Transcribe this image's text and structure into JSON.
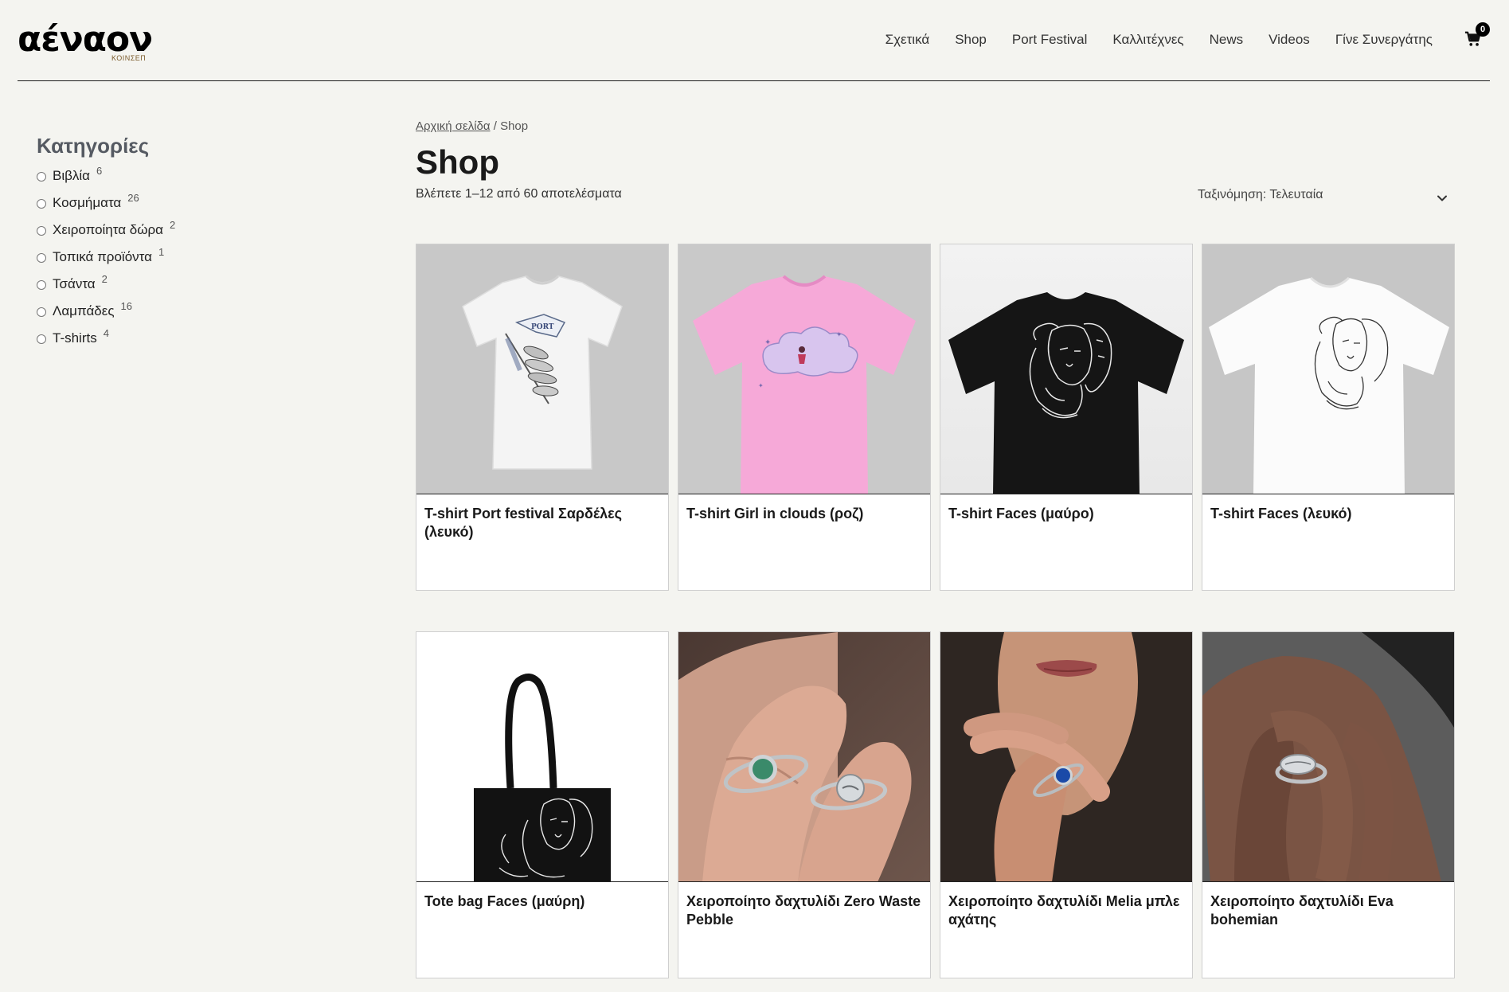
{
  "brand": {
    "logo_text": "αένα",
    "logo_sub": "ΚΟΙΝΣΕΠ"
  },
  "nav": {
    "items": [
      "Σχετικά",
      "Shop",
      "Port Festival",
      "Καλλιτέχνες",
      "News",
      "Videos",
      "Γίνε Συνεργάτης"
    ],
    "cart_count": "0"
  },
  "sidebar": {
    "title": "Κατηγορίες",
    "categories": [
      {
        "label": "Βιβλία",
        "count": "6"
      },
      {
        "label": "Κοσμήματα",
        "count": "26"
      },
      {
        "label": "Χειροποίητα δώρα",
        "count": "2"
      },
      {
        "label": "Τοπικά προϊόντα",
        "count": "1"
      },
      {
        "label": "Τσάντα",
        "count": "2"
      },
      {
        "label": "Λαμπάδες",
        "count": "16"
      },
      {
        "label": "T-shirts",
        "count": "4"
      }
    ]
  },
  "main": {
    "breadcrumb_home": "Αρχική σελίδα",
    "breadcrumb_sep": " / ",
    "breadcrumb_current": "Shop",
    "title": "Shop",
    "results": "Βλέπετε 1–12 από 60 αποτελέσματα",
    "sort_label": "Ταξινόμηση: Τελευταία"
  },
  "products": [
    {
      "title": "T-shirt Port festival Σαρδέλες (λευκό)"
    },
    {
      "title": "T-shirt Girl in clouds (ροζ)"
    },
    {
      "title": "T-shirt Faces (μαύρο)"
    },
    {
      "title": "T-shirt Faces (λευκό)"
    },
    {
      "title": "Tote bag Faces (μαύρη)"
    },
    {
      "title": "Χειροποίητο δαχτυλίδι Zero Waste Pebble"
    },
    {
      "title": "Χειροποίητο δαχτυλίδι Melia μπλε αχάτης"
    },
    {
      "title": "Χειροποίητο δαχτυλίδι Eva bohemian"
    }
  ]
}
